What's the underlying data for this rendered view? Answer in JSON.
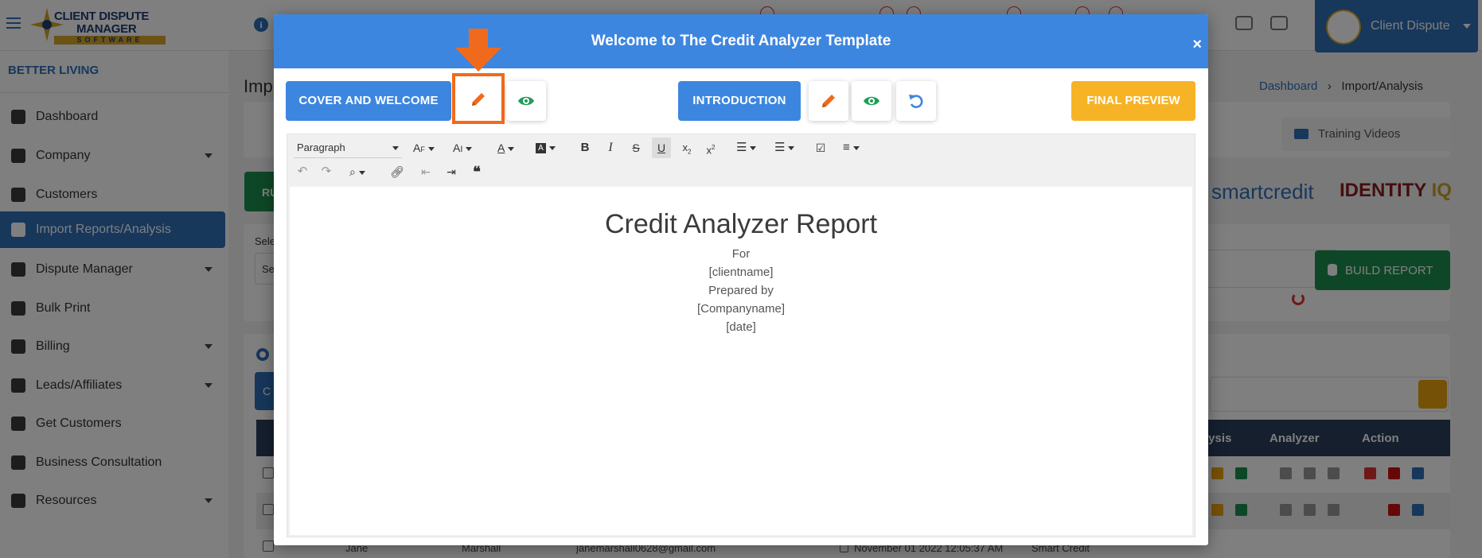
{
  "app": {
    "logo": {
      "line1": "CLIENT DISPUTE",
      "line2": "MANAGER",
      "line3": "SOFTWARE"
    },
    "user_name": "Client Dispute",
    "company_name": "BETTER LIVING",
    "sidebar": {
      "items": [
        {
          "label": "Dashboard",
          "icon": "pie-chart-icon"
        },
        {
          "label": "Company",
          "icon": "building-icon"
        },
        {
          "label": "Customers",
          "icon": "users-icon"
        },
        {
          "label": "Import Reports/Analysis",
          "icon": "file-import-icon",
          "active": true
        },
        {
          "label": "Dispute Manager",
          "icon": "laptop-icon"
        },
        {
          "label": "Bulk Print",
          "icon": "printer-icon"
        },
        {
          "label": "Billing",
          "icon": "receipt-icon"
        },
        {
          "label": "Leads/Affiliates",
          "icon": "chart-line-icon"
        },
        {
          "label": "Get Customers",
          "icon": "graduation-cap-icon"
        },
        {
          "label": "Business Consultation",
          "icon": "headset-icon"
        },
        {
          "label": "Resources",
          "icon": "box-icon"
        }
      ]
    },
    "page_title_partial": "Imp",
    "breadcrumb": {
      "home": "Dashboard",
      "current": "Import/Analysis"
    },
    "training_videos": "Training Videos",
    "partial_button": "RU",
    "partial_select_label": "Sele",
    "partial_select_value": "Se",
    "partial_tab": "C",
    "brands": {
      "smartcredit": "smartcredit",
      "identity": "IDENTITY",
      "iq": "IQ"
    },
    "build_report": "BUILD REPORT",
    "table": {
      "headers": {
        "analysis_partial": "lysis",
        "analyzer": "Analyzer",
        "action": "Action"
      },
      "visible_row": {
        "first_name": "Jane",
        "last_name": "Marshall",
        "email": "janemarshall0628@gmail.com",
        "date": "November 01 2022 12:05:37 AM",
        "source": "Smart Credit"
      }
    }
  },
  "modal": {
    "title": "Welcome to The Credit Analyzer Template",
    "close": "×",
    "sections": {
      "cover": {
        "label": "COVER AND WELCOME",
        "edit_icon": "pencil-icon",
        "preview_icon": "eye-icon"
      },
      "intro": {
        "label": "INTRODUCTION",
        "edit_icon": "pencil-icon",
        "preview_icon": "eye-icon",
        "reset_icon": "undo-icon"
      },
      "final": {
        "label": "FINAL PREVIEW"
      }
    },
    "toolbar": {
      "paragraph": "Paragraph",
      "bold": "B",
      "italic": "I",
      "strike": "S",
      "underline": "U"
    },
    "document": {
      "title": "Credit Analyzer Report",
      "lines": [
        "For",
        "[clientname]",
        "Prepared by",
        "[Companyname]",
        "[date]"
      ]
    }
  },
  "colors": {
    "primary": "#3d86e0",
    "highlight": "#f06a1d",
    "final_preview": "#f6b325",
    "edit_icon": "#f06a1d",
    "preview_icon": "#1d9e57"
  }
}
